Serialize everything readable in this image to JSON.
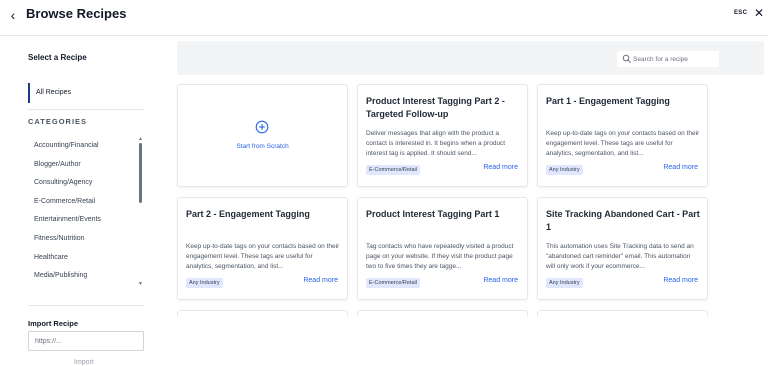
{
  "header": {
    "title": "Browse Recipes",
    "esc_label": "ESC"
  },
  "sidebar": {
    "select_title": "Select a Recipe",
    "all_recipes": "All Recipes",
    "categories_title": "CATEGORIES",
    "categories": [
      "Accounting/Financial",
      "Blogger/Author",
      "Consulting/Agency",
      "E-Commerce/Retail",
      "Entertainment/Events",
      "Fitness/Nutrition",
      "Healthcare",
      "Media/Publishing"
    ],
    "import_title": "Import Recipe",
    "import_placeholder": "https://...",
    "import_button": "Import"
  },
  "search": {
    "placeholder": "Search for a recipe"
  },
  "scratch": {
    "label": "Start from Scratch"
  },
  "cards": [
    {
      "title": "Product Interest Tagging Part 2 - Targeted Follow-up",
      "description": "Deliver messages that align with the product a contact is interested in. It begins when a product interest tag is applied. It should send...",
      "tag": "E-Commerce/Retail",
      "more": "Read more"
    },
    {
      "title": "Part 1 - Engagement Tagging",
      "description": "Keep up-to-date tags on your contacts based on their engagement level. These tags are useful for analytics, segmentation, and list...",
      "tag": "Any Industry",
      "more": "Read more"
    },
    {
      "title": "Part 2 - Engagement Tagging",
      "description": "Keep up-to-date tags on your contacts based on their engagement level. These tags are useful for analytics, segmentation, and list...",
      "tag": "Any Industry",
      "more": "Read more"
    },
    {
      "title": "Product Interest Tagging Part 1",
      "description": "Tag contacts who have repeatedly visited a product page on your website. If they visit the product page two to five times they are tagge...",
      "tag": "E-Commerce/Retail",
      "more": "Read more"
    },
    {
      "title": "Site Tracking Abandoned Cart - Part 1",
      "description": "This automation uses Site Tracking data to send an \"abandoned cart reminder\" email. This automation will only work if your ecommerce...",
      "tag": "Any Industry",
      "more": "Read more"
    }
  ],
  "colors": {
    "accent": "#2563eb",
    "tag_bg": "#e0e7ff",
    "band_bg": "#f3f4f6"
  },
  "icons": {
    "back": "chevron-left-icon",
    "close": "close-icon",
    "search": "search-icon",
    "scratch": "plus-circle-icon"
  }
}
